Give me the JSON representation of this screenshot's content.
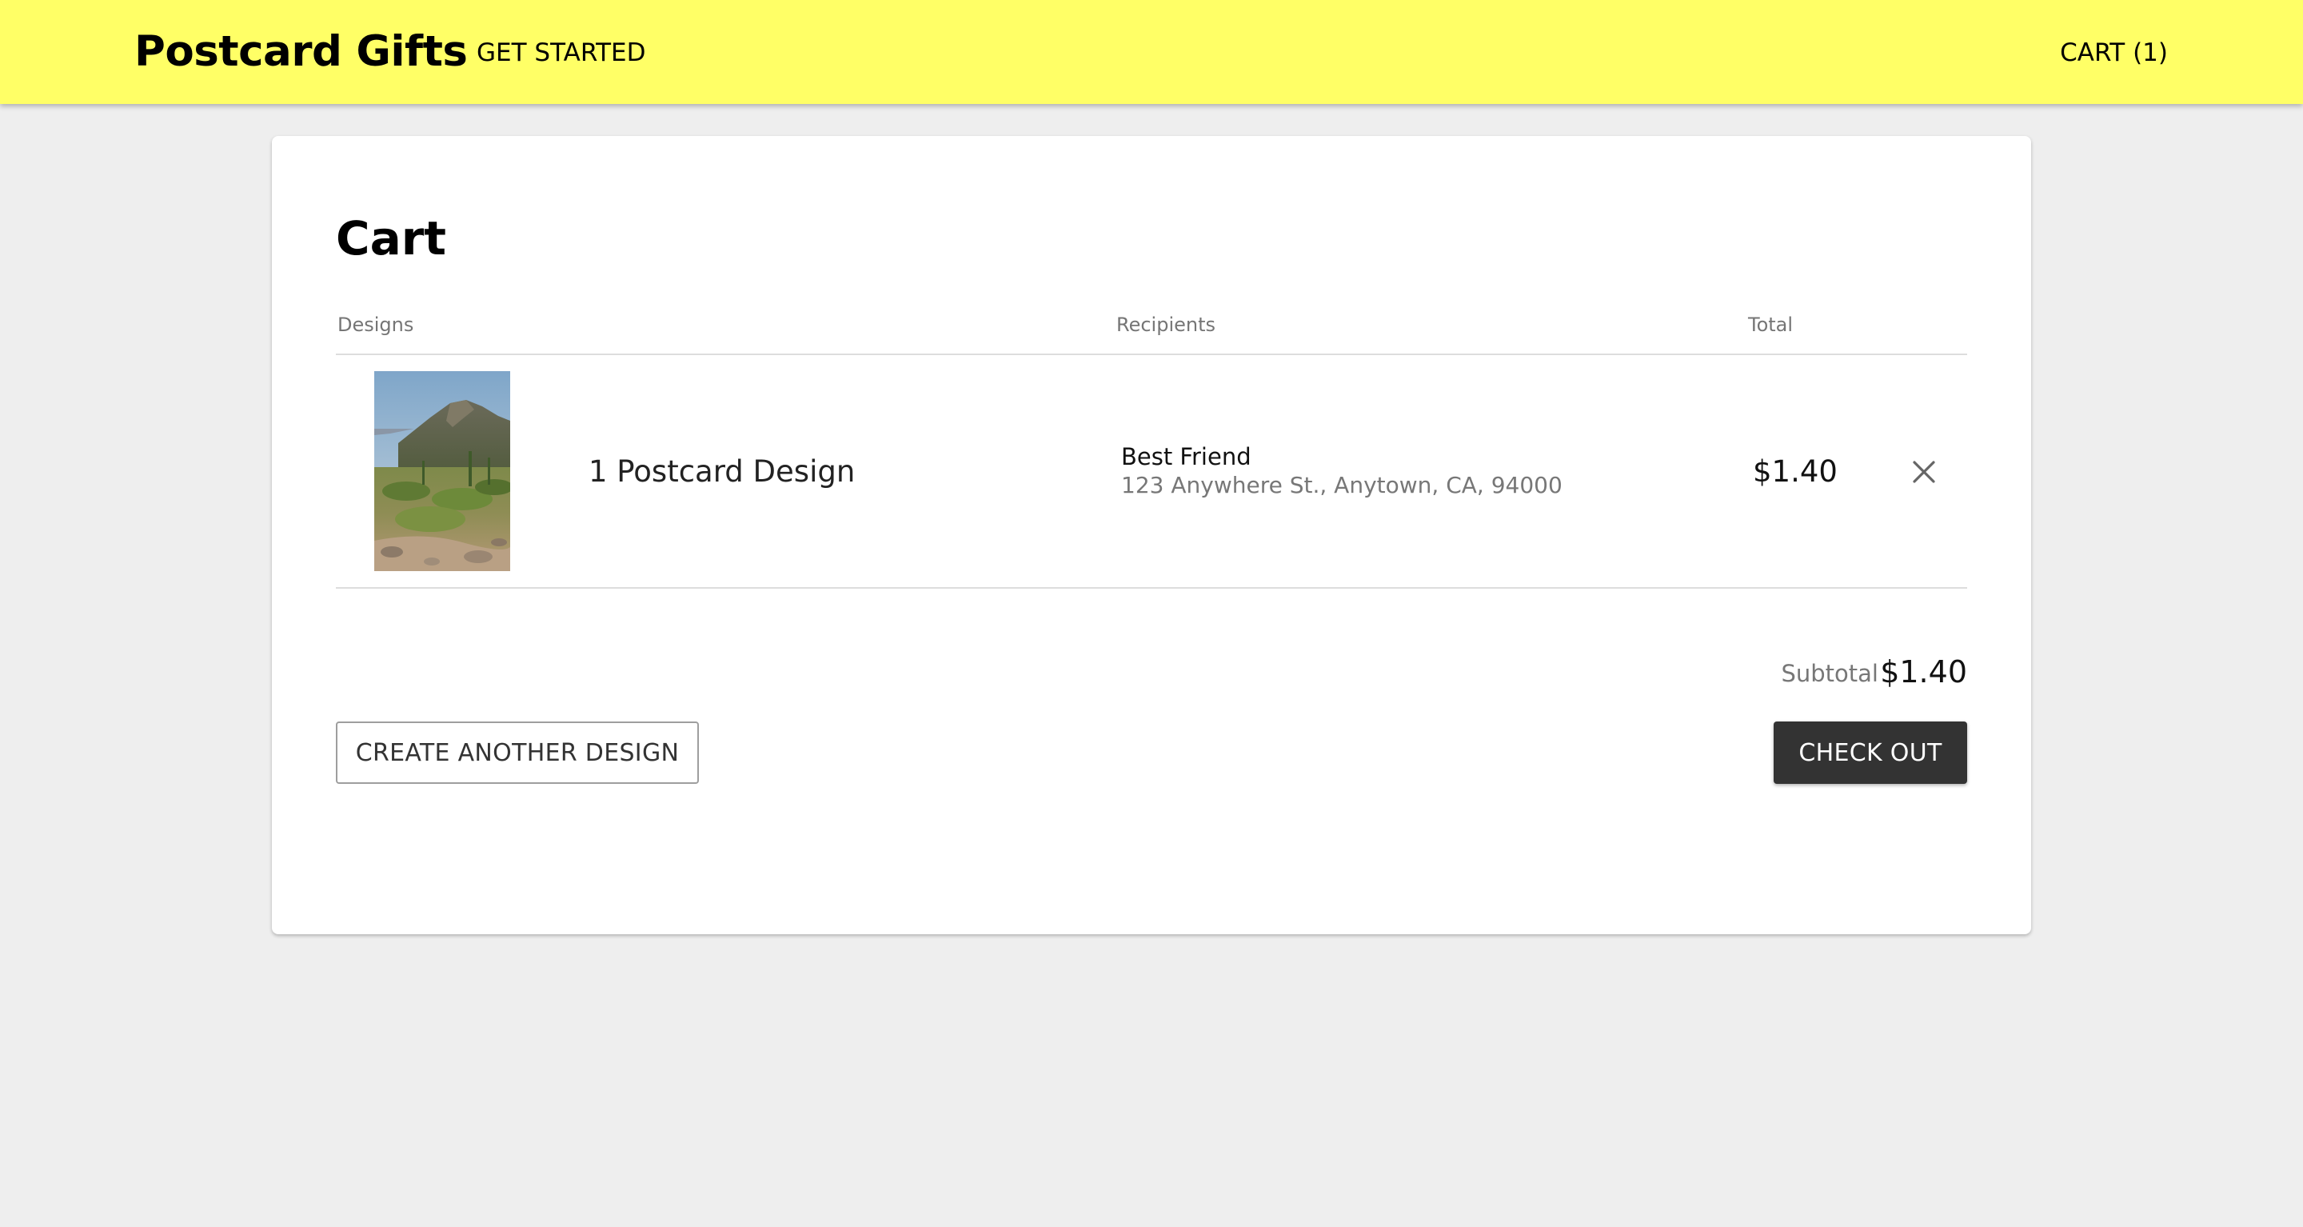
{
  "header": {
    "brand": "Postcard Gifts",
    "nav_get_started": "GET STARTED",
    "cart_link": "CART (1)",
    "background_color": "#ffff66"
  },
  "cart": {
    "title": "Cart",
    "columns": {
      "designs": "Designs",
      "recipients": "Recipients",
      "total": "Total"
    },
    "items": [
      {
        "thumbnail": "desert-mountain-photo",
        "design_label": "1 Postcard Design",
        "recipient_name": "Best Friend",
        "recipient_address": "123 Anywhere St., Anytown, CA, 94000",
        "total": "$1.40",
        "remove_icon": "close-icon"
      }
    ],
    "subtotal_label": "Subtotal",
    "subtotal_value": "$1.40",
    "create_button": "CREATE ANOTHER DESIGN",
    "checkout_button": "CHECK OUT",
    "checkout_color": "#333333"
  }
}
